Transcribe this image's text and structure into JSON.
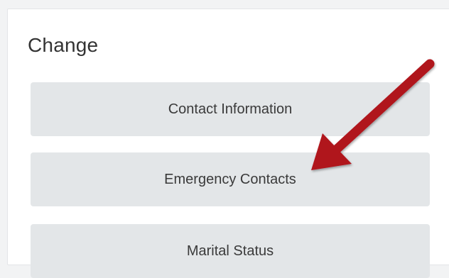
{
  "panel": {
    "title": "Change"
  },
  "actions": [
    {
      "label": "Contact Information"
    },
    {
      "label": "Emergency Contacts"
    },
    {
      "label": "Marital Status"
    }
  ],
  "annotation": {
    "icon": "red-pointer-arrow-icon",
    "color": "#b0131d"
  }
}
